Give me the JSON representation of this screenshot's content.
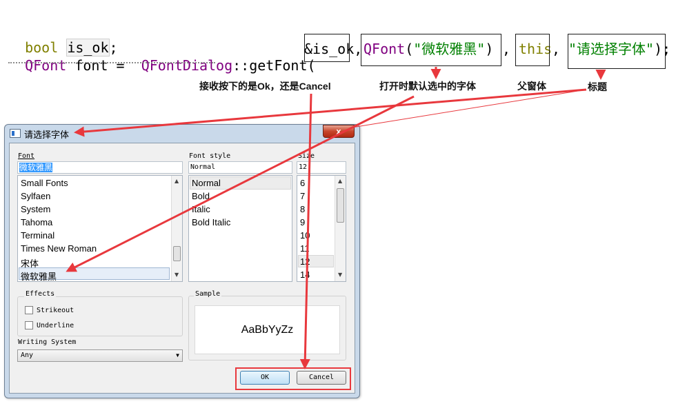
{
  "code": {
    "line1": {
      "type": "bool",
      "var": "is_ok",
      "end": ";"
    },
    "line2": {
      "t1": "QFont",
      "t2": " font = ",
      "t3": "QFontDialog",
      "t4": "::getFont(",
      "a1": "&is_ok",
      "sep1": ",",
      "a2_cls": "QFont",
      "a2_open": "(",
      "a2_str": "\"微软雅黑\"",
      "a2_close": ")",
      "sep2": ",",
      "a3": "this",
      "sep3": ",",
      "a4": "\"请选择字体\"",
      "end": ");"
    }
  },
  "annotations": {
    "arg1": "接收按下的是Ok，还是Cancel",
    "arg2": "打开时默认选中的字体",
    "arg3": "父窗体",
    "arg4": "标题"
  },
  "colors": {
    "arrow": "#e8383d",
    "keyword": "#808000",
    "class": "#800080",
    "string": "#008000"
  },
  "dialog": {
    "title": "请选择字体",
    "close_glyph": "x",
    "font_label": "Font",
    "font_value": "微软雅黑",
    "fonts": [
      "Small Fonts",
      "Sylfaen",
      "System",
      "Tahoma",
      "Terminal",
      "Times New Roman",
      "宋体",
      "微软雅黑"
    ],
    "style_label": "Font style",
    "style_value": "Normal",
    "styles": [
      "Normal",
      "Bold",
      "Italic",
      "Bold Italic"
    ],
    "size_label": "Size",
    "size_value": "12",
    "sizes": [
      "6",
      "7",
      "8",
      "9",
      "10",
      "11",
      "12",
      "14"
    ],
    "effects_label": "Effects",
    "strikeout_label": "Strikeout",
    "underline_label": "Underline",
    "writing_system_label": "Writing System",
    "writing_system_value": "Any",
    "sample_label": "Sample",
    "sample_text": "AaBbYyZz",
    "ok_label": "OK",
    "cancel_label": "Cancel"
  }
}
